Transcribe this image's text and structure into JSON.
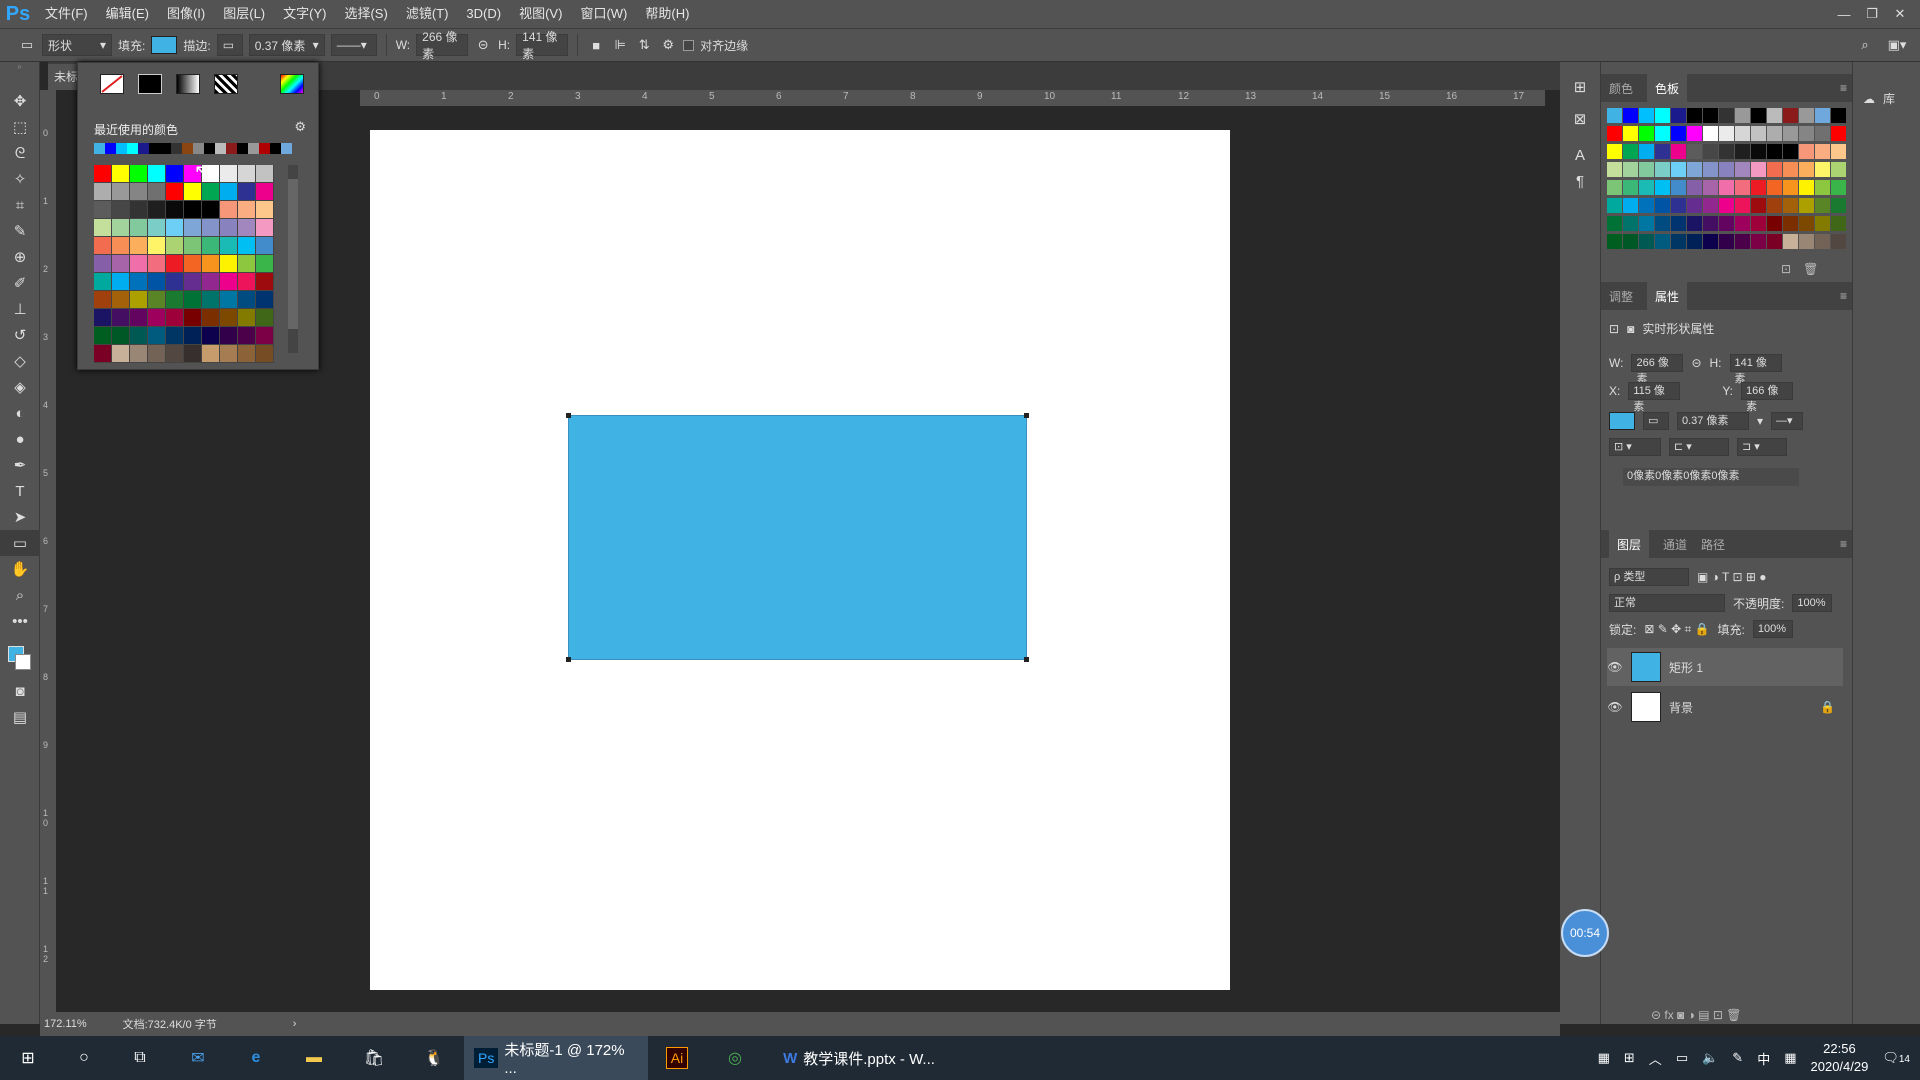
{
  "menubar": {
    "logo": "Ps",
    "items": [
      "文件(F)",
      "编辑(E)",
      "图像(I)",
      "图层(L)",
      "文字(Y)",
      "选择(S)",
      "滤镜(T)",
      "3D(D)",
      "视图(V)",
      "窗口(W)",
      "帮助(H)"
    ]
  },
  "options": {
    "mode": "形状",
    "fill_label": "填充:",
    "stroke_label": "描边:",
    "stroke_width": "0.37 像素",
    "w_label": "W:",
    "w_value": "266 像素",
    "h_label": "H:",
    "h_value": "141 像素",
    "align_edges": "对齐边缘"
  },
  "document": {
    "tab_title": "未标"
  },
  "ruler": {
    "top": [
      "0",
      "1",
      "2",
      "3",
      "4",
      "5",
      "6",
      "7",
      "8",
      "9",
      "10",
      "11",
      "12",
      "13",
      "14",
      "15",
      "16",
      "17"
    ],
    "left": [
      "0",
      "1",
      "2",
      "3",
      "4",
      "5",
      "6",
      "7",
      "8",
      "9",
      "1 0",
      "1 1",
      "1 2"
    ]
  },
  "picker": {
    "recent_title": "最近使用的颜色"
  },
  "status": {
    "zoom": "172.11%",
    "doc": "文档:732.4K/0 字节"
  },
  "panels": {
    "swatch_tabs": [
      "颜色",
      "色板"
    ],
    "prop_tabs": [
      "调整",
      "属性"
    ],
    "prop_title": "实时形状属性",
    "w_label": "W:",
    "w_value": "266 像素",
    "h_label": "H:",
    "h_value": "141 像素",
    "x_label": "X:",
    "x_value": "115 像素",
    "y_label": "Y:",
    "y_value": "166 像素",
    "stroke_value": "0.37 像素",
    "corner_text": "0像素0像素0像素0像素",
    "layer_tabs": [
      "图层",
      "通道",
      "路径"
    ],
    "filter_type": "ρ 类型",
    "blend_mode": "正常",
    "opacity_label": "不透明度:",
    "opacity_value": "100%",
    "lock_label": "锁定:",
    "fill_label": "填充:",
    "fill_value": "100%",
    "layers": [
      {
        "name": "矩形 1"
      },
      {
        "name": "背景"
      }
    ]
  },
  "farright": {
    "lib_label": "库"
  },
  "timer": "00:54",
  "taskbar": {
    "ps_title": "未标题-1 @ 172% ...",
    "ai_label": "Ai",
    "wps_title": "教学课件.pptx - W...",
    "ime": "中",
    "time": "22:56",
    "date": "2020/4/29",
    "notif": "14"
  },
  "colors": {
    "fill": "#40b2e4",
    "ui": "#535353",
    "workspace": "#282828"
  }
}
